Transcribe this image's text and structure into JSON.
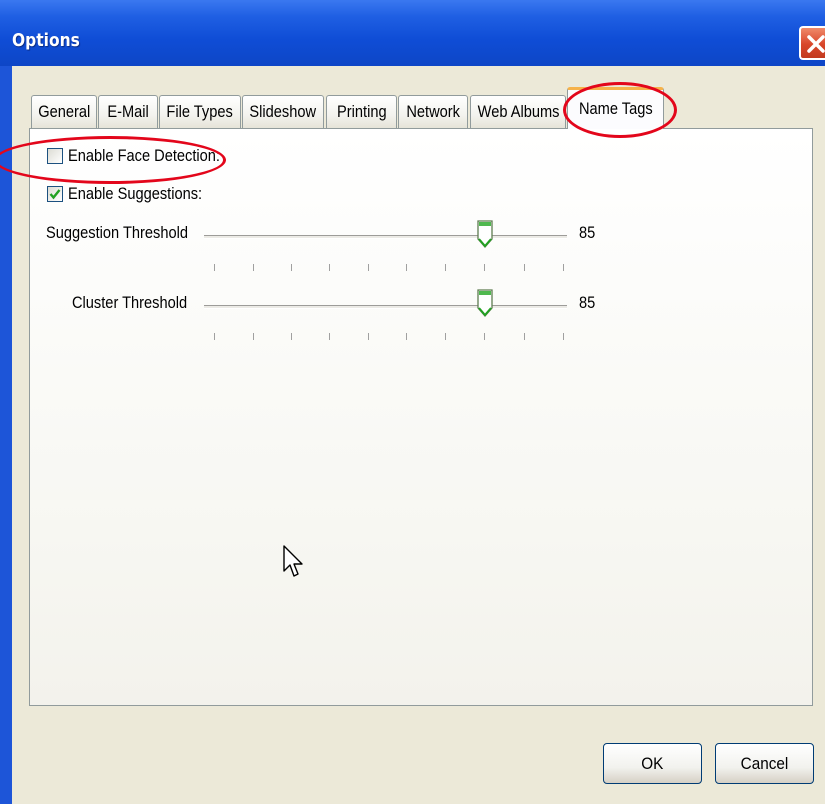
{
  "window": {
    "title": "Options"
  },
  "tabs": [
    {
      "label": "General",
      "active": false
    },
    {
      "label": "E-Mail",
      "active": false
    },
    {
      "label": "File Types",
      "active": false
    },
    {
      "label": "Slideshow",
      "active": false
    },
    {
      "label": "Printing",
      "active": false
    },
    {
      "label": "Network",
      "active": false
    },
    {
      "label": "Web Albums",
      "active": false
    },
    {
      "label": "Name Tags",
      "active": true
    }
  ],
  "options": {
    "face_detection": {
      "label": "Enable Face Detection:",
      "checked": false
    },
    "suggestions": {
      "label": "Enable Suggestions:",
      "checked": true
    }
  },
  "sliders": {
    "suggestion": {
      "label": "Suggestion Threshold",
      "value": "85"
    },
    "cluster": {
      "label": "Cluster Threshold",
      "value": "85"
    }
  },
  "buttons": {
    "ok": "OK",
    "cancel": "Cancel"
  },
  "colors": {
    "titlebar": "#0e46c6",
    "annotation": "#e3061b",
    "active_tab_accent": "#f6b24a",
    "checkmark": "#21a121"
  }
}
